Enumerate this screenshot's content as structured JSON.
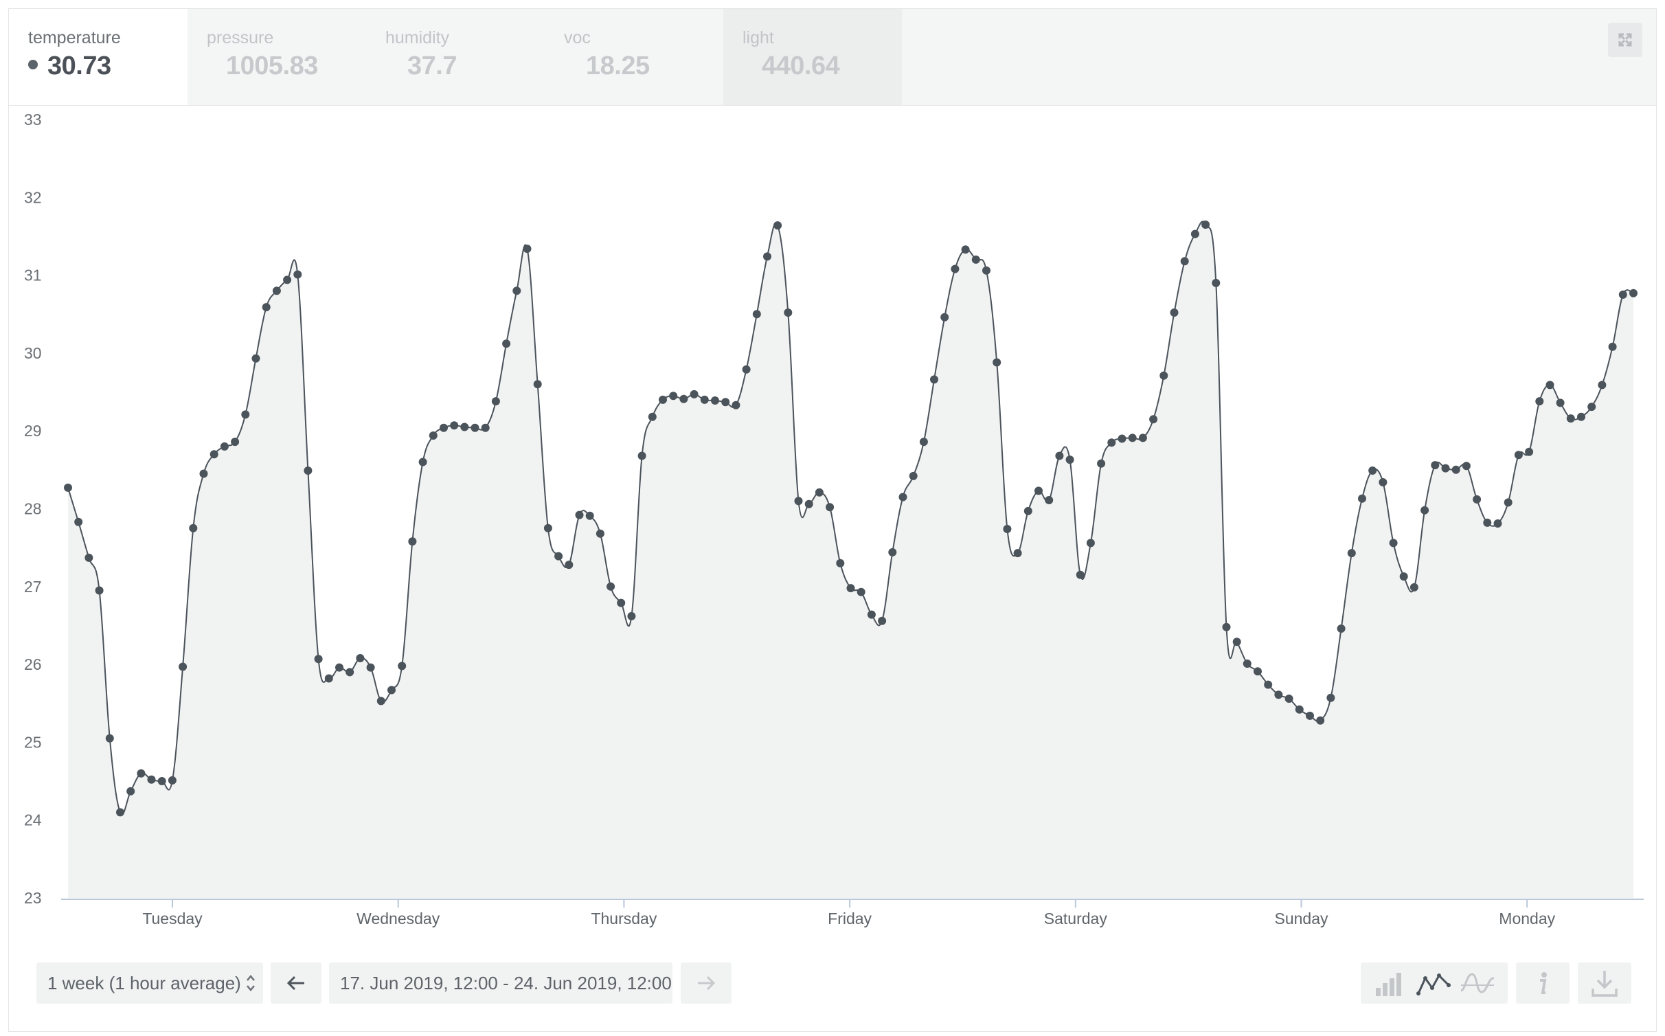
{
  "tabs": [
    {
      "label": "temperature",
      "value": "30.73"
    },
    {
      "label": "pressure",
      "value": "1005.83"
    },
    {
      "label": "humidity",
      "value": "37.7"
    },
    {
      "label": "voc",
      "value": "18.25"
    },
    {
      "label": "light",
      "value": "440.64"
    }
  ],
  "controls": {
    "range_label": "1 week (1 hour average)",
    "date_range": "17. Jun 2019, 12:00 - 24. Jun 2019, 12:00",
    "prev_icon": "arrow-left-icon",
    "next_icon": "arrow-right-icon",
    "chart_buttons": [
      "bar-chart-icon",
      "line-chart-icon",
      "smooth-line-icon",
      "info-icon",
      "download-icon"
    ]
  },
  "colors": {
    "line": "#4b535b",
    "fill": "#f1f2f2",
    "axis": "#b9c7d9"
  },
  "chart_data": {
    "type": "area",
    "series": [
      {
        "name": "temperature",
        "values": [
          28.27,
          27.83,
          27.37,
          26.95,
          25.05,
          24.1,
          24.37,
          24.6,
          24.52,
          24.5,
          24.51,
          25.97,
          27.75,
          28.45,
          28.7,
          28.8,
          28.86,
          29.21,
          29.93,
          30.59,
          30.8,
          30.94,
          31.01,
          28.49,
          26.07,
          25.82,
          25.96,
          25.9,
          26.08,
          25.96,
          25.53,
          25.67,
          25.98,
          27.58,
          28.6,
          28.94,
          29.04,
          29.07,
          29.05,
          29.04,
          29.04,
          29.38,
          30.12,
          30.8,
          31.34,
          29.6,
          27.75,
          27.39,
          27.28,
          27.92,
          27.91,
          27.68,
          27.0,
          26.79,
          26.62,
          28.68,
          29.18,
          29.4,
          29.45,
          29.41,
          29.47,
          29.4,
          29.39,
          29.37,
          29.33,
          29.79,
          30.5,
          31.24,
          31.64,
          30.52,
          28.1,
          28.06,
          28.21,
          28.02,
          27.3,
          26.98,
          26.93,
          26.64,
          26.56,
          27.44,
          28.15,
          28.42,
          28.86,
          29.66,
          30.46,
          31.08,
          31.33,
          31.2,
          31.06,
          29.88,
          27.74,
          27.43,
          27.97,
          28.23,
          28.11,
          28.68,
          28.63,
          27.15,
          27.56,
          28.58,
          28.85,
          28.9,
          28.91,
          28.91,
          29.15,
          29.71,
          30.52,
          31.18,
          31.53,
          31.65,
          30.9,
          26.48,
          26.29,
          26.01,
          25.91,
          25.74,
          25.61,
          25.56,
          25.42,
          25.34,
          25.28,
          25.57,
          26.46,
          27.43,
          28.13,
          28.49,
          28.34,
          27.56,
          27.13,
          26.99,
          27.98,
          28.56,
          28.52,
          28.5,
          28.55,
          28.12,
          27.82,
          27.81,
          28.08,
          28.69,
          28.73,
          29.38,
          29.59,
          29.36,
          29.16,
          29.18,
          29.31,
          29.59,
          30.08,
          30.75,
          30.77
        ]
      }
    ],
    "ylim": [
      23,
      33
    ],
    "yticks": [
      "23",
      "24",
      "25",
      "26",
      "27",
      "28",
      "29",
      "30",
      "31",
      "32",
      "33"
    ],
    "xtick_labels": [
      "Tuesday",
      "Wednesday",
      "Thursday",
      "Friday",
      "Saturday",
      "Sunday",
      "Monday"
    ],
    "xrange": "17. Jun 2019, 12:00 - 24. Jun 2019, 12:00",
    "grid": false,
    "legend": "none"
  }
}
